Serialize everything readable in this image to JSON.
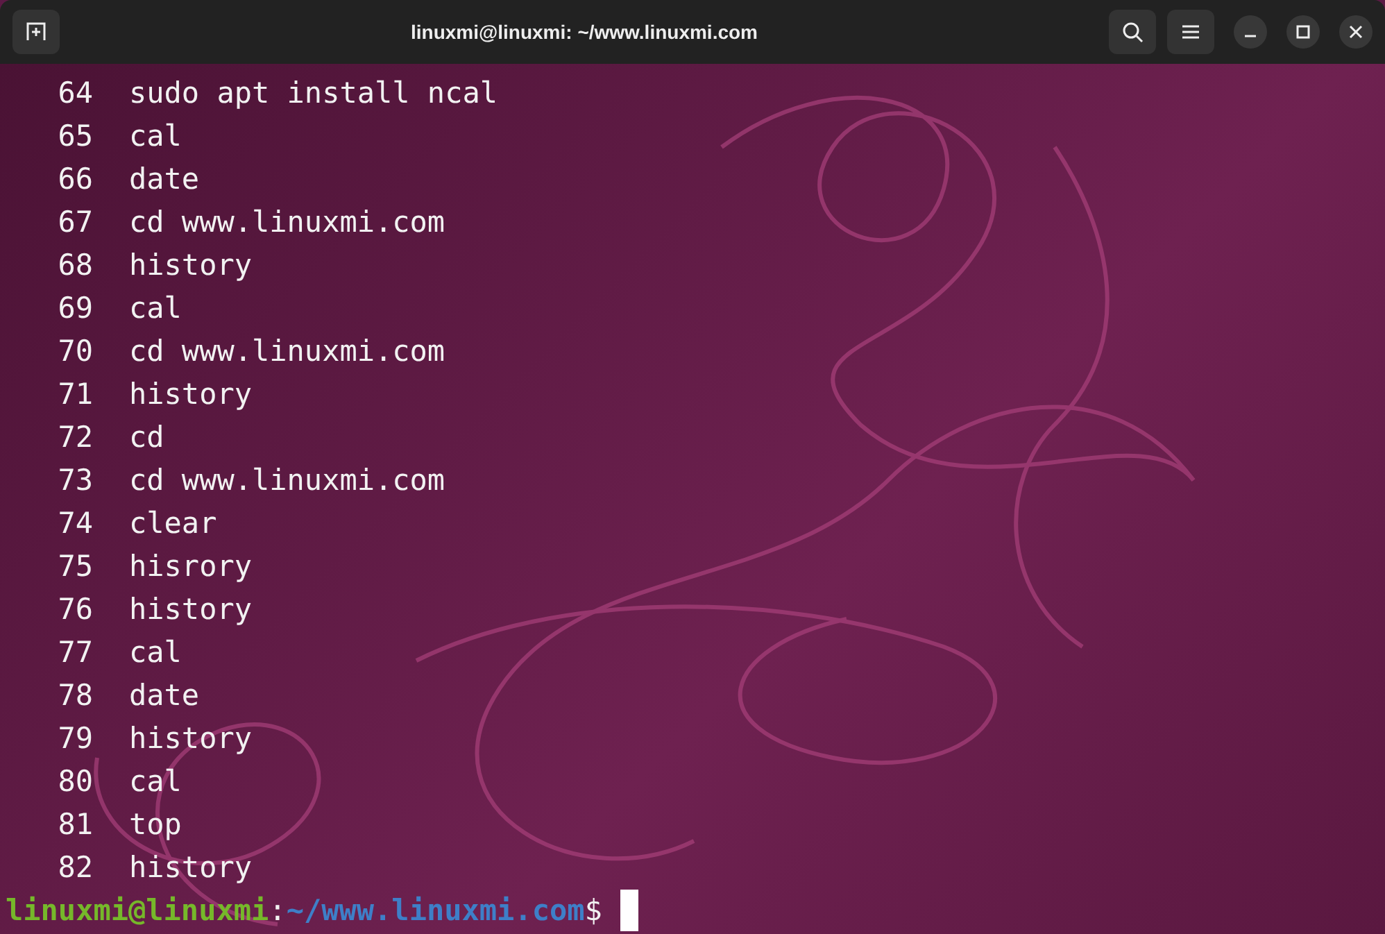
{
  "window": {
    "title": "linuxmi@linuxmi: ~/www.linuxmi.com"
  },
  "history": [
    {
      "number": "64",
      "command": "sudo apt install ncal"
    },
    {
      "number": "65",
      "command": "cal"
    },
    {
      "number": "66",
      "command": "date"
    },
    {
      "number": "67",
      "command": "cd www.linuxmi.com"
    },
    {
      "number": "68",
      "command": "history"
    },
    {
      "number": "69",
      "command": "cal"
    },
    {
      "number": "70",
      "command": "cd www.linuxmi.com"
    },
    {
      "number": "71",
      "command": "history"
    },
    {
      "number": "72",
      "command": "cd"
    },
    {
      "number": "73",
      "command": "cd www.linuxmi.com"
    },
    {
      "number": "74",
      "command": "clear"
    },
    {
      "number": "75",
      "command": "hisrory"
    },
    {
      "number": "76",
      "command": "history"
    },
    {
      "number": "77",
      "command": "cal"
    },
    {
      "number": "78",
      "command": "date"
    },
    {
      "number": "79",
      "command": "history"
    },
    {
      "number": "80",
      "command": "cal"
    },
    {
      "number": "81",
      "command": "top"
    },
    {
      "number": "82",
      "command": "history"
    }
  ],
  "prompt": {
    "user_host": "linuxmi@linuxmi",
    "separator": ":",
    "path": "~/www.linuxmi.com",
    "symbol": "$"
  }
}
